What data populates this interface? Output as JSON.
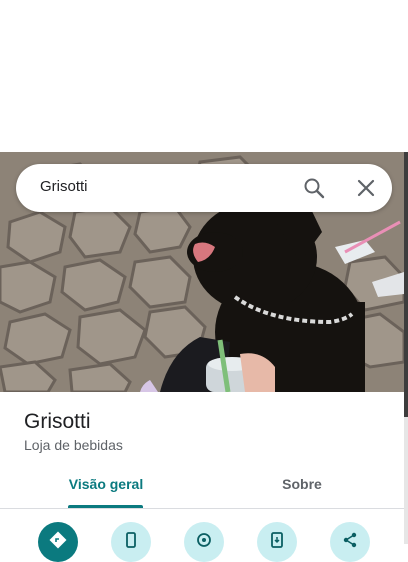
{
  "search": {
    "query": "Grisotti"
  },
  "place": {
    "name": "Grisotti",
    "category": "Loja de bebidas"
  },
  "tabs": [
    {
      "label": "Visão geral",
      "active": true
    },
    {
      "label": "Sobre",
      "active": false
    }
  ],
  "actions": [
    {
      "icon": "directions-icon"
    },
    {
      "icon": "phone-icon"
    },
    {
      "icon": "location-icon"
    },
    {
      "icon": "save-to-phone-icon"
    },
    {
      "icon": "share-icon"
    }
  ],
  "colors": {
    "accent": "#0b7a7f",
    "action_bg": "#c9eef1"
  }
}
